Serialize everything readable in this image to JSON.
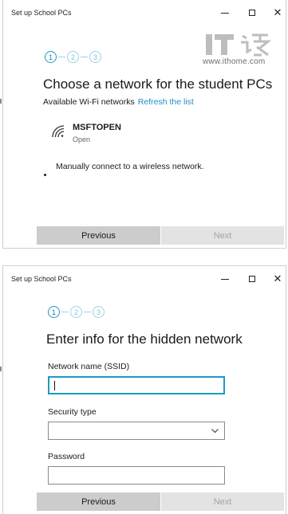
{
  "watermark": {
    "logo_text": "IT之家",
    "url": "www.ithome.com"
  },
  "window1": {
    "title": "Set up School PCs",
    "steps": [
      "1",
      "2",
      "3"
    ],
    "heading": "Choose a network for the student PCs",
    "subheading": "Available Wi-Fi networks",
    "refresh_link": "Refresh the list",
    "network": {
      "name": "MSFTOPEN",
      "status": "Open",
      "icon": "wifi-icon"
    },
    "manual_connect": "Manually connect to a wireless network.",
    "buttons": {
      "previous": "Previous",
      "next": "Next"
    }
  },
  "window2": {
    "title": "Set up School PCs",
    "steps": [
      "1",
      "2",
      "3"
    ],
    "heading": "Enter info for the hidden network",
    "ssid_label": "Network name (SSID)",
    "ssid_value": "",
    "security_label": "Security type",
    "security_value": "",
    "password_label": "Password",
    "password_value": "",
    "buttons": {
      "previous": "Previous",
      "next": "Next"
    }
  },
  "colors": {
    "accent": "#1c9ac6",
    "link": "#1c8fc0",
    "button_enabled": "#cccccc",
    "button_disabled": "#e3e3e3"
  }
}
